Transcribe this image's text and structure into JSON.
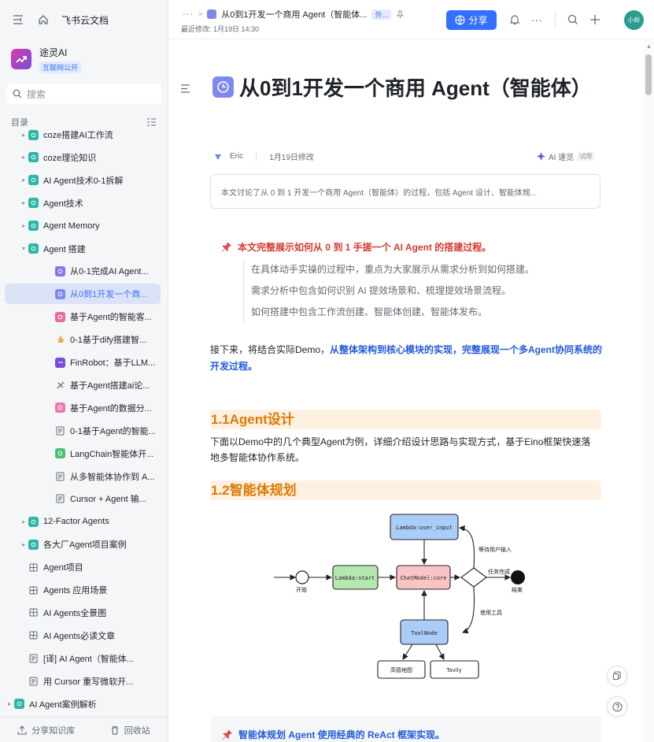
{
  "app": {
    "name": "飞书云文档"
  },
  "space": {
    "name": "途灵AI",
    "badge": "互联网公开"
  },
  "search": {
    "placeholder": "搜索"
  },
  "toc": {
    "label": "目录"
  },
  "tree": [
    {
      "label": "coze搭建AI工作流",
      "level": 1,
      "arrow": "▸",
      "icon": "teal",
      "top": 0
    },
    {
      "label": "coze理论知识",
      "level": 1,
      "arrow": "▸",
      "icon": "teal"
    },
    {
      "label": "AI Agent技术0-1拆解",
      "level": 1,
      "arrow": "▸",
      "icon": "teal"
    },
    {
      "label": "Agent技术",
      "level": 1,
      "arrow": "▸",
      "icon": "teal"
    },
    {
      "label": "Agent Memory",
      "level": 1,
      "arrow": "▸",
      "icon": "teal"
    },
    {
      "label": "Agent 搭建",
      "level": 1,
      "arrow": "▾",
      "icon": "teal"
    },
    {
      "label": "从0-1完成AI Agent...",
      "level": 2,
      "arrow": "",
      "icon": "purple"
    },
    {
      "label": "从0到1开发一个商...",
      "level": 2,
      "arrow": "",
      "icon": "violet",
      "active": true
    },
    {
      "label": "基于Agent的智能客...",
      "level": 2,
      "arrow": "",
      "icon": "pink"
    },
    {
      "label": "0-1基于dify搭建智...",
      "level": 2,
      "arrow": "",
      "icon": "emoji-hand"
    },
    {
      "label": "FinRobot：基于LLM...",
      "level": 2,
      "arrow": "",
      "icon": "robot"
    },
    {
      "label": "基于Agent搭建ai论...",
      "level": 2,
      "arrow": "",
      "icon": "tools"
    },
    {
      "label": "基于Agent的数据分...",
      "level": 2,
      "arrow": "",
      "icon": "pink2"
    },
    {
      "label": "0-1基于Agent的智能...",
      "level": 2,
      "arrow": "",
      "icon": "doc"
    },
    {
      "label": "LangChain智能体开...",
      "level": 2,
      "arrow": "",
      "icon": "green"
    },
    {
      "label": "从多智能体协作到 A...",
      "level": 2,
      "arrow": "",
      "icon": "doc"
    },
    {
      "label": "Cursor + Agent 输...",
      "level": 2,
      "arrow": "",
      "icon": "doc"
    },
    {
      "label": "12-Factor Agents",
      "level": 1,
      "arrow": "▸",
      "icon": "teal"
    },
    {
      "label": "各大厂Agent项目案例",
      "level": 1,
      "arrow": "▸",
      "icon": "teal"
    },
    {
      "label": "Agent项目",
      "level": 1,
      "arrow": "",
      "icon": "grid"
    },
    {
      "label": "Agents 应用场景",
      "level": 1,
      "arrow": "",
      "icon": "grid"
    },
    {
      "label": "AI Agents全景图",
      "level": 1,
      "arrow": "",
      "icon": "grid"
    },
    {
      "label": "AI Agents必读文章",
      "level": 1,
      "arrow": "",
      "icon": "grid"
    },
    {
      "label": "[译] AI Agent（智能体...",
      "level": 1,
      "arrow": "",
      "icon": "doc"
    },
    {
      "label": "用 Cursor 重写微软开...",
      "level": 1,
      "arrow": "",
      "icon": "doc"
    },
    {
      "label": "AI Agent案例解析",
      "level": 0,
      "arrow": "▸",
      "icon": "teal"
    }
  ],
  "bottom": {
    "share": "分享知识库",
    "trash": "回收站"
  },
  "topbar": {
    "dots": "···",
    "doc_title": "从0到1开发一个商用 Agent（智能体...",
    "ext": "外...",
    "last_modified": "最近修改: 1月19日 14:30",
    "share_label": "分享",
    "avatar": "小岭"
  },
  "doc": {
    "title": "从0到1开发一个商用 Agent（智能体）",
    "author": "Eric",
    "modified": "1月19日修改",
    "ai_speed": "AI 速览",
    "trial": "试用",
    "summary": "本文讨论了从 0 到 1 开发一个商用 Agent（智能体）的过程，包括 Agent 设计、智能体规...",
    "callout_title": "本文完整展示如何从 0 到 1 手搓一个 AI Agent 的搭建过程。",
    "callout_lines": [
      "在具体动手实操的过程中，重点为大家展示从需求分析到如何搭建。",
      "需求分析中包含如何识别 AI 提效场景和、梳理提效场景流程。",
      "如何搭建中包含工作流创建、智能体创建、智能体发布。"
    ],
    "para1_plain": "接下来，将结合实际Demo，",
    "para1_bold": "从整体架构到核心模块的实现，完整展现一个多Agent协同系统的开发过程。",
    "h2_1": "1.1Agent设计",
    "para2": "下面以Demo中的几个典型Agent为例，详细介绍设计思路与实现方式，基于Eino框架快速落地多智能体协作系统。",
    "h2_2": "1.2智能体规划",
    "callout2": "智能体规划 Agent 使用经典的 ReAct 框架实现。"
  },
  "diagram": {
    "nodes": {
      "user_input": "Lambda:user_input",
      "start": "Lambda:start",
      "core": "ChatModel:core",
      "toolnode": "ToolNode",
      "gaode": "高德地图",
      "tavily": "Tavily"
    },
    "labels": {
      "start": "开始",
      "end": "结束",
      "wait": "等待用户输入",
      "done": "任务完成",
      "tool": "使用工具"
    },
    "colors": {
      "blue": "#a9cdf7",
      "green": "#b5e8b0",
      "pink": "#fbc4c4"
    }
  },
  "colors": {
    "accent": "#3370ff",
    "red": "#d83931",
    "orange": "#de7802",
    "highlight_bg": "#fef1e1"
  }
}
